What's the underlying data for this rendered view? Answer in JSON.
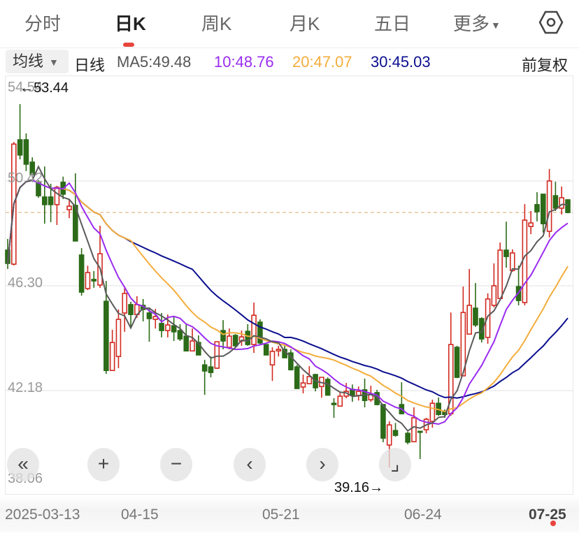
{
  "tabs": [
    {
      "label": "分时",
      "active": false
    },
    {
      "label": "日K",
      "active": true
    },
    {
      "label": "周K",
      "active": false
    },
    {
      "label": "月K",
      "active": false
    },
    {
      "label": "五日",
      "active": false
    },
    {
      "label": "更多",
      "active": false
    }
  ],
  "settings_icon": "hexagon-settings-icon",
  "ma_bar": {
    "select_label": "均线",
    "period_label": "日线",
    "ma5": "MA5:49.48",
    "ma10": "10:48.76",
    "ma20": "20:47.07",
    "ma30": "30:45.03",
    "adjust_label": "前复权"
  },
  "colors": {
    "up": "#d12a20",
    "down": "#2c6b18",
    "ma5": "#5a5a5a",
    "ma10": "#9a2cf0",
    "ma20": "#f4ad3c",
    "ma30": "#0b0f8f",
    "accent": "#e8453c"
  },
  "controls": [
    {
      "name": "jump-start-button",
      "glyph": "«"
    },
    {
      "name": "zoom-in-button",
      "glyph": "+"
    },
    {
      "name": "zoom-out-button",
      "glyph": "−"
    },
    {
      "name": "scroll-left-button",
      "glyph": "‹"
    },
    {
      "name": "scroll-right-button",
      "glyph": "›"
    },
    {
      "name": "fullscreen-button",
      "glyph": "⌟"
    }
  ],
  "chart_data": {
    "type": "candlestick",
    "title": "",
    "ylim": [
      38.06,
      54.54
    ],
    "y_ticks": [
      "54.54",
      "50.42",
      "46.30",
      "42.18",
      "38.06"
    ],
    "x_ticks": [
      {
        "label": "2025-03-13",
        "index": 0
      },
      {
        "label": "04-15",
        "index": 21
      },
      {
        "label": "05-21",
        "index": 44
      },
      {
        "label": "06-24",
        "index": 67
      },
      {
        "label": "07-25",
        "index": 91
      }
    ],
    "annotations": {
      "max": "←53.44",
      "min": "39.16→",
      "max_index": 2,
      "min_index": 62
    },
    "last_price": 49.18,
    "ma_periods": [
      5,
      10,
      20,
      30
    ],
    "ohlc": [
      [
        47.7,
        48.14,
        46.96,
        47.18
      ],
      [
        47.15,
        51.95,
        47.1,
        51.87
      ],
      [
        52.04,
        53.44,
        51.27,
        51.44
      ],
      [
        52.04,
        52.29,
        50.81,
        51.08
      ],
      [
        51.16,
        51.35,
        50.56,
        50.67
      ],
      [
        50.39,
        50.45,
        49.76,
        49.84
      ],
      [
        49.79,
        50.99,
        48.74,
        49.49
      ],
      [
        49.79,
        50.31,
        48.8,
        49.49
      ],
      [
        49.49,
        50.23,
        48.69,
        50.17
      ],
      [
        50.37,
        50.59,
        49.71,
        49.9
      ],
      [
        49.29,
        49.71,
        48.96,
        49.43
      ],
      [
        49.46,
        50.72,
        48.06,
        48.06
      ],
      [
        47.51,
        47.78,
        45.91,
        46.05
      ],
      [
        46.19,
        47.09,
        46.13,
        46.82
      ],
      [
        46.55,
        46.88,
        46.22,
        46.49
      ],
      [
        46.33,
        48.66,
        46.22,
        47.56
      ],
      [
        45.69,
        46.49,
        42.84,
        42.97
      ],
      [
        42.97,
        44.57,
        42.97,
        44.07
      ],
      [
        43.52,
        45.37,
        43.06,
        44.98
      ],
      [
        45.23,
        46.27,
        44.49,
        46.0
      ],
      [
        45.56,
        45.67,
        44.68,
        45.17
      ],
      [
        45.17,
        45.89,
        45.04,
        45.56
      ],
      [
        45.53,
        45.78,
        44.9,
        45.37
      ],
      [
        45.23,
        45.45,
        44.1,
        45.01
      ],
      [
        44.98,
        45.39,
        44.62,
        45.09
      ],
      [
        44.82,
        45.23,
        44.27,
        44.54
      ],
      [
        44.54,
        45.17,
        44.27,
        44.76
      ],
      [
        44.73,
        45.09,
        44.13,
        44.49
      ],
      [
        44.54,
        44.79,
        44.13,
        44.21
      ],
      [
        44.32,
        44.82,
        43.74,
        43.74
      ],
      [
        43.74,
        44.62,
        43.74,
        44.13
      ],
      [
        44.07,
        44.35,
        43.58,
        43.58
      ],
      [
        43.19,
        43.39,
        42.01,
        42.95
      ],
      [
        43.11,
        43.52,
        42.7,
        42.89
      ],
      [
        43.06,
        44.1,
        43.03,
        44.1
      ],
      [
        44.54,
        44.95,
        43.8,
        44.13
      ],
      [
        43.88,
        44.62,
        43.8,
        44.32
      ],
      [
        44.35,
        44.4,
        43.88,
        43.94
      ],
      [
        44.13,
        44.54,
        43.94,
        44.29
      ],
      [
        44.51,
        44.79,
        43.94,
        43.99
      ],
      [
        43.99,
        45.64,
        43.66,
        45.14
      ],
      [
        44.87,
        44.98,
        43.99,
        44.05
      ],
      [
        43.99,
        43.99,
        43.58,
        43.58
      ],
      [
        43.19,
        43.88,
        42.56,
        43.72
      ],
      [
        43.74,
        43.94,
        43.52,
        43.8
      ],
      [
        43.8,
        43.94,
        43.47,
        43.47
      ],
      [
        43.66,
        43.8,
        42.97,
        43.0
      ],
      [
        43.11,
        43.19,
        42.26,
        42.26
      ],
      [
        42.32,
        42.81,
        42.07,
        42.48
      ],
      [
        42.45,
        43.14,
        42.45,
        42.73
      ],
      [
        42.81,
        42.84,
        42.15,
        42.29
      ],
      [
        42.34,
        42.7,
        41.9,
        42.7
      ],
      [
        42.62,
        42.7,
        42.0,
        42.0
      ],
      [
        41.68,
        41.88,
        41.11,
        41.63
      ],
      [
        41.57,
        42.09,
        41.57,
        41.96
      ],
      [
        41.96,
        42.48,
        41.88,
        42.15
      ],
      [
        42.23,
        42.42,
        41.74,
        41.99
      ],
      [
        41.99,
        42.34,
        41.79,
        42.15
      ],
      [
        42.21,
        42.65,
        41.52,
        41.79
      ],
      [
        41.82,
        42.37,
        41.74,
        42.04
      ],
      [
        42.1,
        42.21,
        41.6,
        41.63
      ],
      [
        41.63,
        41.63,
        40.15,
        40.31
      ],
      [
        40.04,
        40.97,
        39.16,
        40.83
      ],
      [
        40.61,
        40.91,
        40.37,
        40.42
      ],
      [
        41.63,
        42.51,
        41.27,
        41.27
      ],
      [
        40.5,
        40.56,
        40.07,
        40.15
      ],
      [
        40.17,
        41.52,
        40.17,
        41.11
      ],
      [
        40.58,
        40.58,
        39.49,
        40.56
      ],
      [
        40.64,
        41.11,
        40.5,
        41.05
      ],
      [
        40.97,
        41.82,
        40.72,
        41.68
      ],
      [
        41.68,
        41.91,
        41.19,
        41.24
      ],
      [
        41.33,
        41.44,
        41.11,
        41.24
      ],
      [
        41.27,
        45.25,
        41.19,
        43.99
      ],
      [
        43.88,
        43.94,
        42.67,
        42.7
      ],
      [
        42.76,
        46.27,
        42.76,
        45.25
      ],
      [
        44.4,
        46.96,
        44.4,
        45.53
      ],
      [
        45.42,
        46.41,
        44.68,
        44.76
      ],
      [
        45.01,
        45.06,
        44.07,
        44.21
      ],
      [
        44.27,
        46.0,
        44.02,
        45.78
      ],
      [
        45.53,
        47.18,
        45.45,
        46.3
      ],
      [
        45.8,
        48.0,
        45.8,
        47.7
      ],
      [
        47.7,
        48.82,
        47.01,
        47.45
      ],
      [
        46.9,
        47.73,
        46.85,
        47.59
      ],
      [
        46.27,
        47.09,
        45.53,
        45.72
      ],
      [
        45.64,
        49.51,
        45.53,
        48.88
      ],
      [
        48.63,
        49.24,
        48.33,
        48.77
      ],
      [
        49.49,
        49.98,
        48.83,
        49.21
      ],
      [
        49.9,
        49.9,
        48.39,
        48.74
      ],
      [
        48.44,
        50.89,
        48.2,
        50.42
      ],
      [
        49.84,
        50.39,
        49.24,
        49.35
      ],
      [
        49.35,
        50.2,
        49.1,
        49.76
      ],
      [
        49.68,
        49.68,
        49.15,
        49.18
      ]
    ]
  }
}
